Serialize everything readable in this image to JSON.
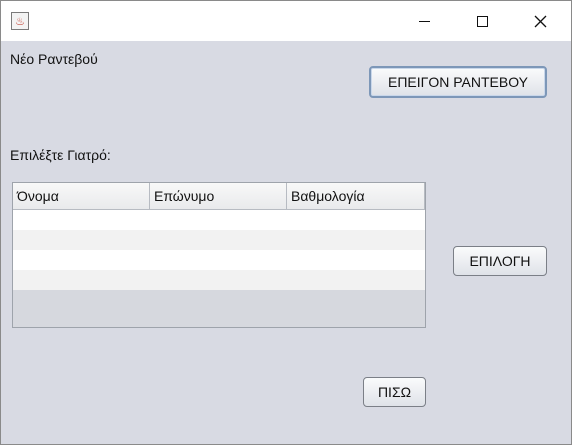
{
  "window": {
    "controls": {
      "minimize": "minimize-icon",
      "maximize": "maximize-icon",
      "close": "close-icon"
    }
  },
  "header": {
    "title": "Νέο Ραντεβού"
  },
  "actions": {
    "confirm_label": "ΕΠΕΙΓΟΝ ΡΑΝΤΕΒΟΥ",
    "select_label": "ΕΠΙΛΟΓΗ",
    "back_label": "ΠΙΣΩ"
  },
  "doctors": {
    "prompt": "Επιλέξτε Γιατρό:",
    "columns": [
      "Όνομα",
      "Επώνυμο",
      "Βαθμολογία"
    ],
    "rows": []
  }
}
